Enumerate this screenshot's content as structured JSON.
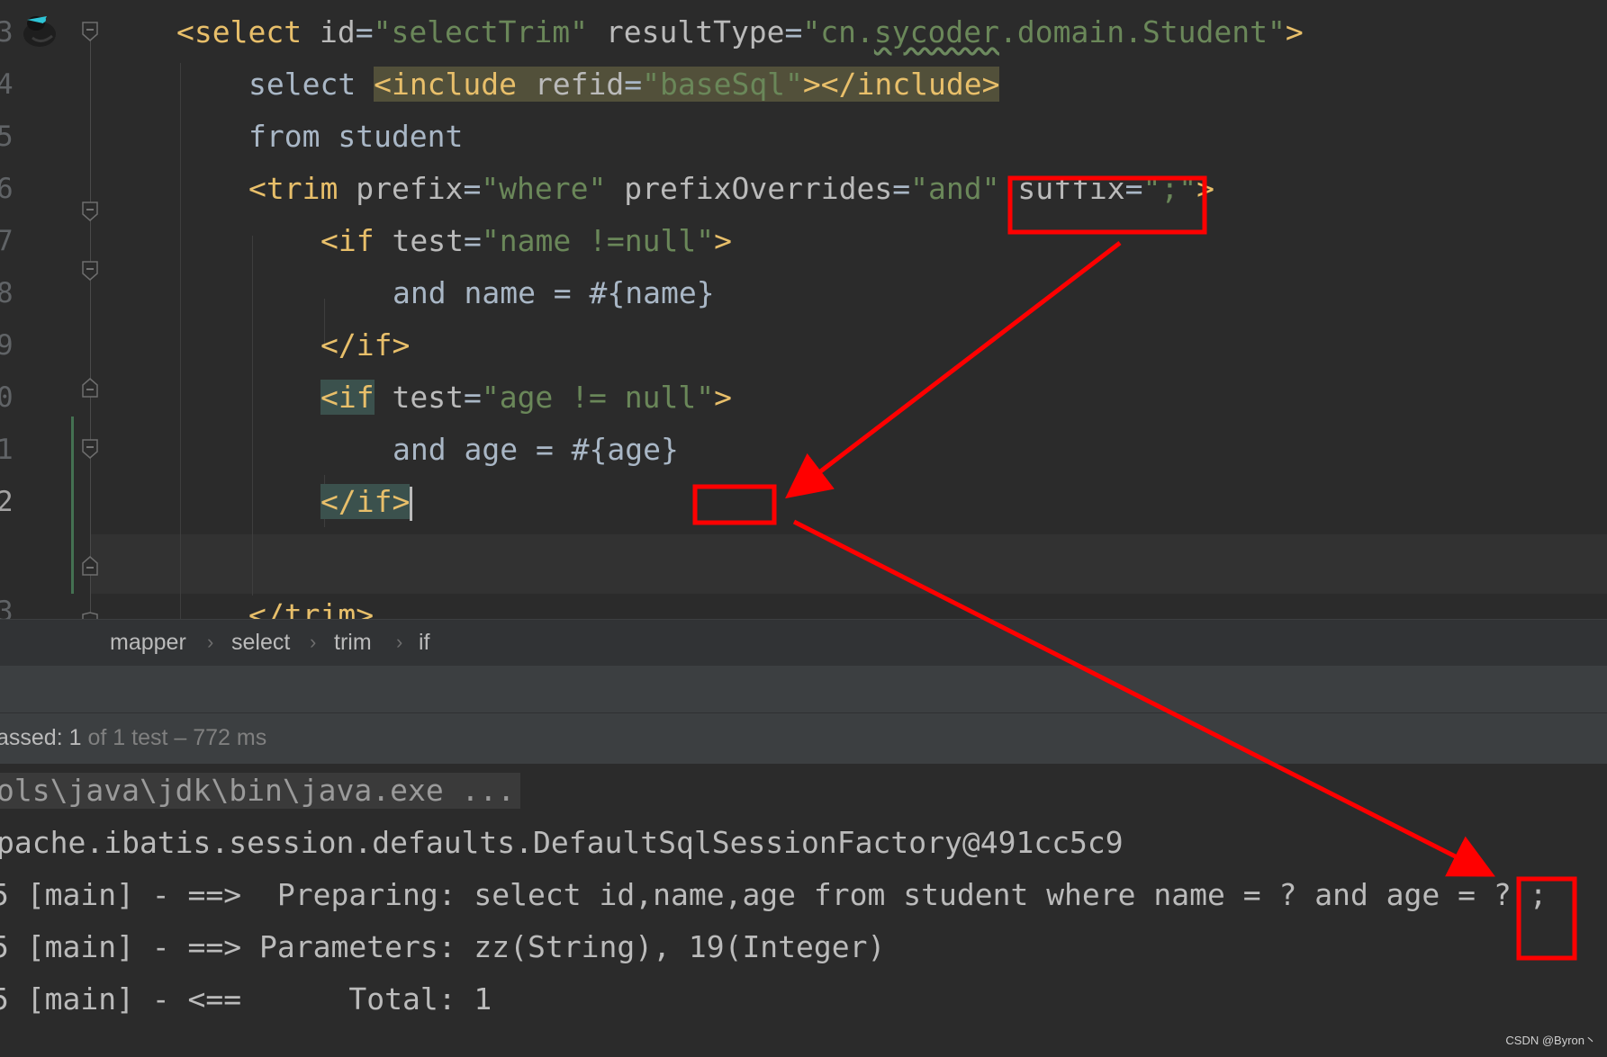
{
  "editor": {
    "line_numbers": [
      "3",
      "4",
      "5",
      "6",
      "7",
      "8",
      "9",
      "0",
      "1",
      "2",
      "3"
    ],
    "lines": {
      "l3": {
        "open": "<select ",
        "id_attr": "id",
        "eq1": "=",
        "id_val": "\"selectTrim\"",
        "rt_attr": " resultType",
        "eq2": "=",
        "rt_q": "\"cn.",
        "rt_squig": "sycoder",
        "rt_rest": ".domain.Student\"",
        "close": ">"
      },
      "l4": {
        "kw": "select ",
        "inc_open": "<include ",
        "inc_attr": "refid",
        "inc_eq": "=",
        "inc_val": "\"baseSql\"",
        "inc_close": "></include>"
      },
      "l5": {
        "text": "from student"
      },
      "l6": {
        "open": "<trim ",
        "a1": "prefix",
        "e1": "=",
        "v1": "\"where\"",
        "a2": " prefixOverrides",
        "e2": "=",
        "v2": "\"and\"",
        "a3": " suffix",
        "e3": "=",
        "v3": "\";\"",
        "close": ">"
      },
      "l7": {
        "open": "<if ",
        "a": "test",
        "e": "=",
        "v": "\"name !=null\"",
        "close": ">"
      },
      "l8": {
        "text": "and name = #{name}"
      },
      "l9": {
        "tag": "</if>"
      },
      "l10": {
        "open": "<if",
        "a": " test",
        "e": "=",
        "v": "\"age != null\"",
        "close": ">"
      },
      "l11": {
        "text": "and age = #{age}"
      },
      "l12": {
        "tag": "</if>"
      },
      "l13": {
        "tag": "</trim>"
      }
    }
  },
  "breadcrumb": [
    "mapper",
    "select",
    "trim",
    "if"
  ],
  "breadcrumb_separator": "›",
  "test_status": {
    "passed_label": "assed:",
    "passed_count": "1",
    "rest": " of 1 test – 772 ms"
  },
  "console": {
    "lines": [
      "ols\\java\\jdk\\bin\\java.exe ...",
      "pache.ibatis.session.defaults.DefaultSqlSessionFactory@491cc5c9",
      "5 [main] - ==>  Preparing: select id,name,age from student where name = ? and age = ? ;",
      "5 [main] - ==> Parameters: zz(String), 19(Integer)",
      "5 [main] - <==      Total: 1"
    ]
  },
  "watermark": "CSDN @Byron丶",
  "colors": {
    "background": "#2b2b2b",
    "tag": "#e8bf6a",
    "attribute": "#bababa",
    "string": "#6a8759",
    "text": "#a9b7c6",
    "annotation": "#ff0000"
  },
  "icons": {
    "logo": "mybatis-bird-icon",
    "fold": "fold-marker-icon"
  }
}
